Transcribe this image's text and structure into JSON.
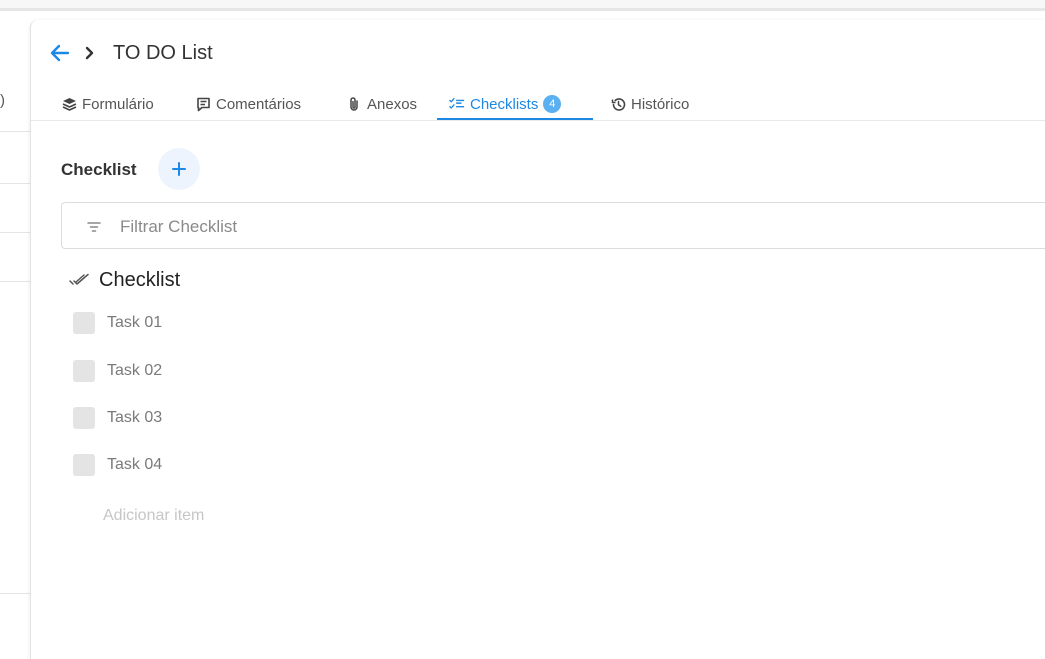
{
  "left_panel": {
    "glyph": ")"
  },
  "header": {
    "title": "TO DO List"
  },
  "tabs": [
    {
      "label": "Formulário",
      "icon": "layers-icon"
    },
    {
      "label": "Comentários",
      "icon": "comment-icon"
    },
    {
      "label": "Anexos",
      "icon": "paperclip-icon"
    },
    {
      "label": "Checklists",
      "icon": "checklist-icon",
      "badge": "4",
      "active": true
    },
    {
      "label": "Histórico",
      "icon": "history-icon"
    }
  ],
  "section": {
    "title": "Checklist",
    "add_button": "+"
  },
  "filter": {
    "placeholder": "Filtrar Checklist",
    "value": ""
  },
  "checklist": {
    "title": "Checklist",
    "items": [
      {
        "label": "Task 01",
        "checked": false
      },
      {
        "label": "Task 02",
        "checked": false
      },
      {
        "label": "Task 03",
        "checked": false
      },
      {
        "label": "Task 04",
        "checked": false
      }
    ],
    "add_item_placeholder": "Adicionar item"
  },
  "colors": {
    "accent": "#1e88e5",
    "badge": "#5ab0f0",
    "checkbox": "#e4e4e4"
  }
}
